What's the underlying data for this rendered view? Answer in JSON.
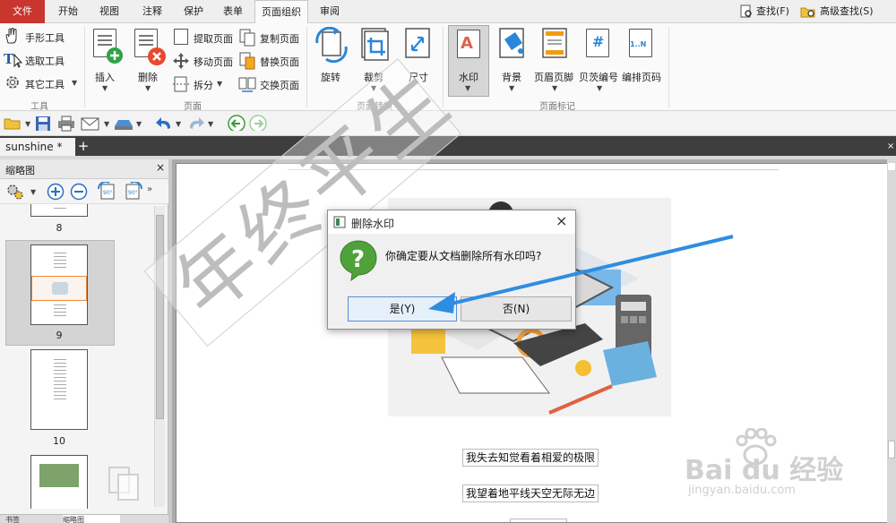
{
  "menu": {
    "file": "文件",
    "tabs": [
      "开始",
      "视图",
      "注释",
      "保护",
      "表单",
      "页面组织",
      "审阅"
    ],
    "active_tab": "页面组织",
    "search": "查找(F)",
    "advanced_search": "高级查找(S)"
  },
  "ribbon": {
    "tools_group": {
      "hand": "手形工具",
      "select": "选取工具",
      "other": "其它工具",
      "label": "工具"
    },
    "page_group": {
      "insert": "插入",
      "delete": "删除",
      "extract": "提取页面",
      "move": "移动页面",
      "split": "拆分",
      "copy": "复制页面",
      "replace": "替换页面",
      "swap": "交换页面",
      "label": "页面"
    },
    "transform_group": {
      "rotate": "旋转",
      "crop": "裁剪",
      "size": "尺寸",
      "label": "页面转换"
    },
    "mark_group": {
      "watermark": "水印",
      "background": "背景",
      "header_footer": "页眉页脚",
      "bates": "贝茨编号",
      "page_number": "编排页码",
      "label": "页面标记",
      "bates_icon_text": "#",
      "page_number_icon_text": "1..N"
    }
  },
  "doc_tab": {
    "name": "sunshine *",
    "add": "+"
  },
  "sidepanel": {
    "title": "缩略图",
    "close": "×",
    "pages": [
      "8",
      "9",
      "10"
    ],
    "bottom_tabs": [
      "书签",
      "缩略图"
    ]
  },
  "document": {
    "watermark_text": "年终平生",
    "line1": "我失去知觉看着相爱的极限",
    "line2": "我望着地平线天空无际无边"
  },
  "dialog": {
    "title": "删除水印",
    "message": "你确定要从文档删除所有水印吗?",
    "yes": "是(Y)",
    "no": "否(N)",
    "close": "×"
  },
  "site_watermark": {
    "logo": "Bai du 经验",
    "url": "jingyan.baidu.com"
  },
  "colors": {
    "file_tab": "#c8362e",
    "arrow": "#2e8de0",
    "question_icon": "#4fa23a"
  }
}
